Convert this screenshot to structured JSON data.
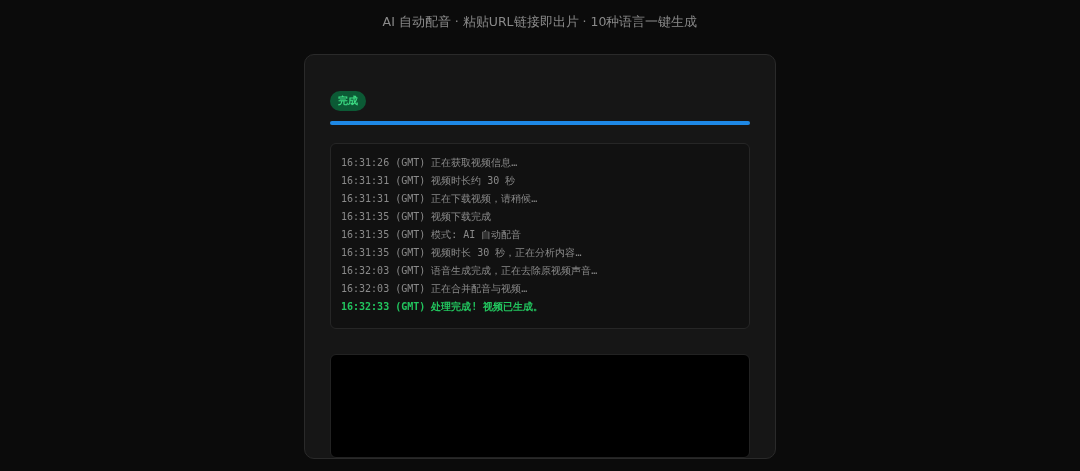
{
  "header": {
    "subtitle": "AI 自动配音 · 粘贴URL链接即出片 · 10种语言一键生成"
  },
  "status": {
    "label": "完成",
    "kind": "done"
  },
  "progress": {
    "level": 1.0
  },
  "log": [
    {
      "time": "16:31:26 (GMT)",
      "text": "正在获取视频信息…",
      "kind": "info"
    },
    {
      "time": "16:31:31 (GMT)",
      "text": "视频时长约 30 秒",
      "kind": "info"
    },
    {
      "time": "16:31:31 (GMT)",
      "text": "正在下载视频，请稍候…",
      "kind": "info"
    },
    {
      "time": "16:31:35 (GMT)",
      "text": "视频下载完成",
      "kind": "info"
    },
    {
      "time": "16:31:35 (GMT)",
      "text": "模式: AI 自动配音",
      "kind": "info"
    },
    {
      "time": "16:31:35 (GMT)",
      "text": "视频时长 30 秒，正在分析内容…",
      "kind": "info"
    },
    {
      "time": "16:32:03 (GMT)",
      "text": "语音生成完成，正在去除原视频声音…",
      "kind": "info"
    },
    {
      "time": "16:32:03 (GMT)",
      "text": "正在合并配音与视频…",
      "kind": "info"
    },
    {
      "time": "16:32:33 (GMT)",
      "text": "处理完成! 视频已生成。",
      "kind": "success"
    }
  ],
  "video": {
    "kind": "player"
  }
}
